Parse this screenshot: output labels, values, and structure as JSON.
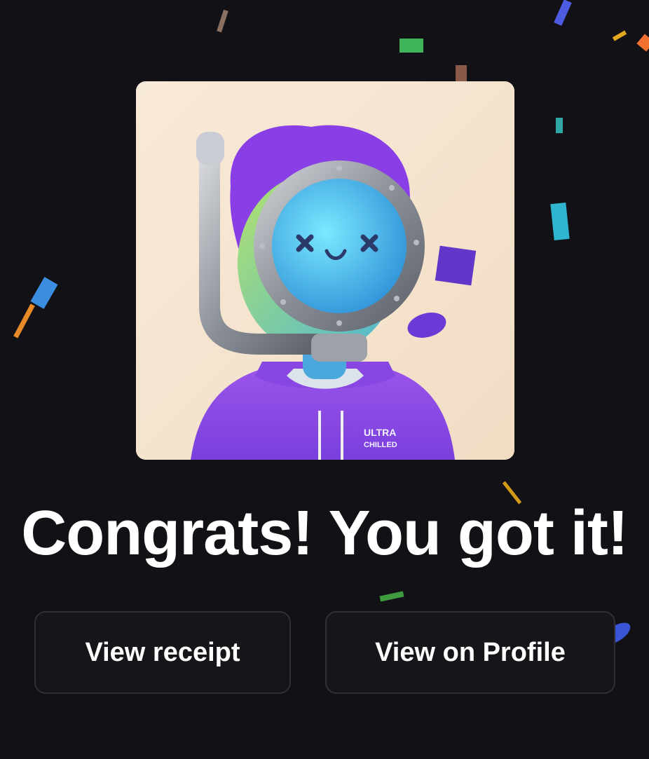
{
  "nft": {
    "image_alt": "3D character with purple hair, porthole diving helmet and snorkel, wearing a purple hoodie",
    "hoodie_text": "ULTRA CHILLED"
  },
  "headline": "Congrats! You got it!",
  "actions": {
    "view_receipt_label": "View receipt",
    "view_profile_label": "View on Profile"
  },
  "colors": {
    "background": "#121216",
    "button_background": "#16161a",
    "button_border": "#2f2f35",
    "text": "#ffffff",
    "card_background": "#f4e3cc"
  }
}
